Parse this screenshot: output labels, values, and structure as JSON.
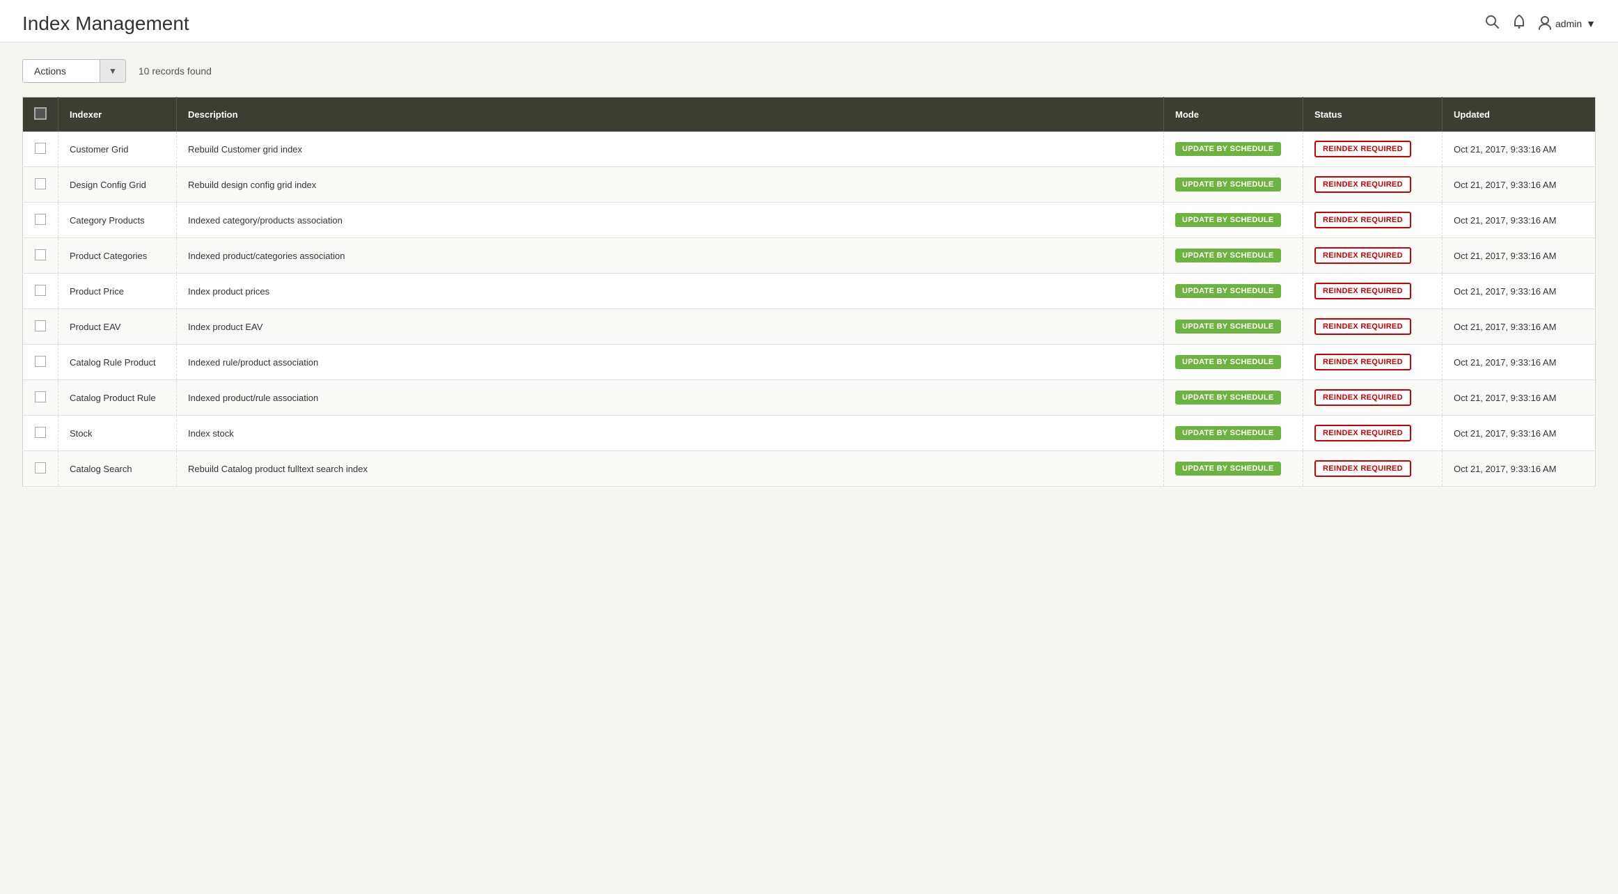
{
  "page": {
    "title": "Index Management"
  },
  "header": {
    "user_label": "admin",
    "search_icon": "🔍",
    "bell_icon": "🔔",
    "user_icon": "👤",
    "dropdown_icon": "▼"
  },
  "toolbar": {
    "actions_label": "Actions",
    "records_count": "10 records found"
  },
  "table": {
    "columns": [
      "",
      "Indexer",
      "Description",
      "Mode",
      "Status",
      "Updated"
    ],
    "rows": [
      {
        "indexer": "Customer Grid",
        "description": "Rebuild Customer grid index",
        "mode": "UPDATE BY SCHEDULE",
        "status": "REINDEX REQUIRED",
        "updated": "Oct 21, 2017, 9:33:16 AM"
      },
      {
        "indexer": "Design Config Grid",
        "description": "Rebuild design config grid index",
        "mode": "UPDATE BY SCHEDULE",
        "status": "REINDEX REQUIRED",
        "updated": "Oct 21, 2017, 9:33:16 AM"
      },
      {
        "indexer": "Category Products",
        "description": "Indexed category/products association",
        "mode": "UPDATE BY SCHEDULE",
        "status": "REINDEX REQUIRED",
        "updated": "Oct 21, 2017, 9:33:16 AM"
      },
      {
        "indexer": "Product Categories",
        "description": "Indexed product/categories association",
        "mode": "UPDATE BY SCHEDULE",
        "status": "REINDEX REQUIRED",
        "updated": "Oct 21, 2017, 9:33:16 AM"
      },
      {
        "indexer": "Product Price",
        "description": "Index product prices",
        "mode": "UPDATE BY SCHEDULE",
        "status": "REINDEX REQUIRED",
        "updated": "Oct 21, 2017, 9:33:16 AM"
      },
      {
        "indexer": "Product EAV",
        "description": "Index product EAV",
        "mode": "UPDATE BY SCHEDULE",
        "status": "REINDEX REQUIRED",
        "updated": "Oct 21, 2017, 9:33:16 AM"
      },
      {
        "indexer": "Catalog Rule Product",
        "description": "Indexed rule/product association",
        "mode": "UPDATE BY SCHEDULE",
        "status": "REINDEX REQUIRED",
        "updated": "Oct 21, 2017, 9:33:16 AM"
      },
      {
        "indexer": "Catalog Product Rule",
        "description": "Indexed product/rule association",
        "mode": "UPDATE BY SCHEDULE",
        "status": "REINDEX REQUIRED",
        "updated": "Oct 21, 2017, 9:33:16 AM"
      },
      {
        "indexer": "Stock",
        "description": "Index stock",
        "mode": "UPDATE BY SCHEDULE",
        "status": "REINDEX REQUIRED",
        "updated": "Oct 21, 2017, 9:33:16 AM"
      },
      {
        "indexer": "Catalog Search",
        "description": "Rebuild Catalog product fulltext search index",
        "mode": "UPDATE BY SCHEDULE",
        "status": "REINDEX REQUIRED",
        "updated": "Oct 21, 2017, 9:33:16 AM"
      }
    ]
  }
}
